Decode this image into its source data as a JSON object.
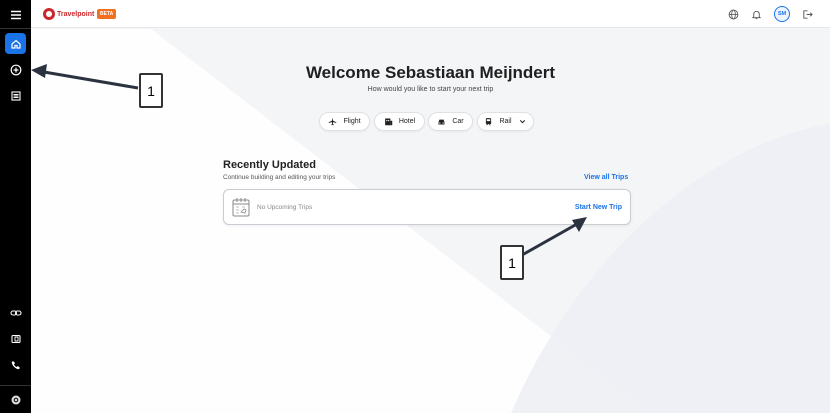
{
  "app": {
    "logo_text": "Travelpoint",
    "beta_badge": "BETA"
  },
  "header": {
    "avatar_initials": "SM"
  },
  "main": {
    "welcome": "Welcome Sebastiaan Meijndert",
    "subtitle": "How would you like to start your next trip",
    "modes": [
      {
        "label": "Flight",
        "icon": "airplane-icon"
      },
      {
        "label": "Hotel",
        "icon": "hotel-icon"
      },
      {
        "label": "Car",
        "icon": "car-icon"
      },
      {
        "label": "Rail",
        "icon": "train-icon"
      }
    ]
  },
  "recent": {
    "title": "Recently Updated",
    "subtitle": "Continue building and editing your trips",
    "view_all": "View all Trips",
    "empty_text": "No Upcoming Trips",
    "start_new": "Start New Trip"
  },
  "annotations": {
    "callout_1": "1",
    "callout_2": "1"
  },
  "colors": {
    "accent": "#1a73e8",
    "brand": "#c9282d",
    "beta": "#f37021",
    "sidebar": "#000000"
  }
}
